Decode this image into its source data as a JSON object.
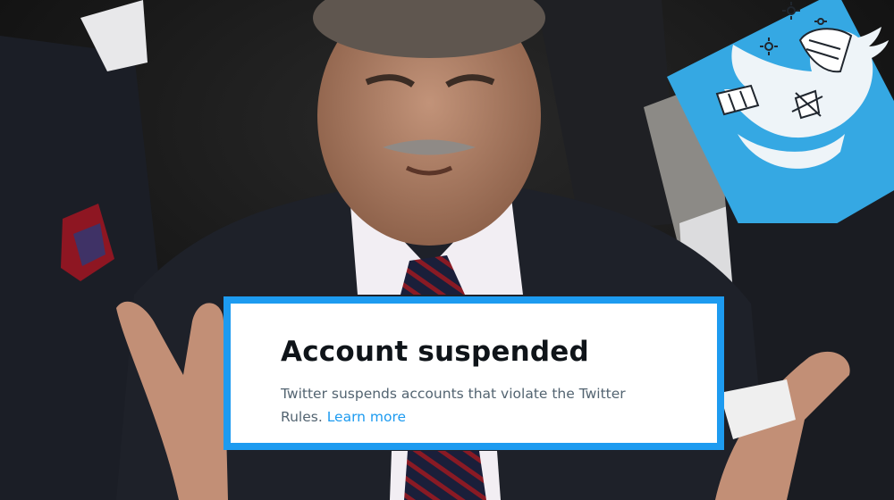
{
  "notice": {
    "title": "Account suspended",
    "message": "Twitter suspends accounts that violate the Twitter Rules.",
    "link_label": "Learn more"
  },
  "colors": {
    "card_border": "#1d9bf0",
    "title_text": "#0f1419",
    "body_text": "#536471",
    "link": "#1d9bf0",
    "badge_background": "#35a8e3"
  },
  "icons": [
    "twitter-bird-icon",
    "bandage-icon",
    "dizzy-star-icon"
  ]
}
